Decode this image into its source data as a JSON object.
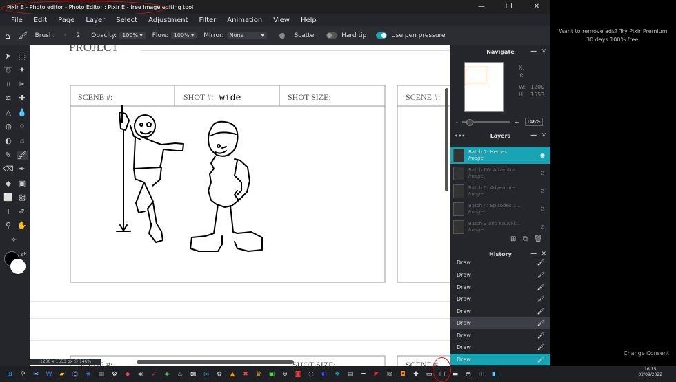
{
  "window": {
    "title": "Pixlr E - Photo editor - Photo Editor : Pixlr E - free image editing tool"
  },
  "menu": [
    "File",
    "Edit",
    "Page",
    "Layer",
    "Select",
    "Adjustment",
    "Filter",
    "Animation",
    "View",
    "Help"
  ],
  "options": {
    "brush_label": "Brush:",
    "brush_dot": "·",
    "brush_size": "2",
    "opacity_label": "Opacity:",
    "opacity_value": "100%",
    "flow_label": "Flow:",
    "flow_value": "100%",
    "mirror_label": "Mirror:",
    "mirror_value": "None",
    "scatter_label": "Scatter",
    "hardtip_label": "Hard tip",
    "penpressure_label": "Use pen pressure"
  },
  "canvas": {
    "project_label": "PROJECT",
    "scene_label": "SCENE #:",
    "shot_label": "SHOT #:",
    "shot_handwriting": "wide",
    "size_label": "SHOT SIZE:",
    "scene_label_2": "SCENE #:",
    "bottom_scene": "SCENE #:",
    "bottom_shot_size": "SHOT SIZE:",
    "bottom_scene_2": "SCENE #"
  },
  "status": {
    "dimensions": "1200 x 1553 px @ 146%"
  },
  "navigate": {
    "title": "Navigate",
    "x_label": "X:",
    "y_label": "Y:",
    "w_label": "W:",
    "w_value": "1200",
    "h_label": "H:",
    "h_value": "1553",
    "zoom_minus": "-",
    "zoom_plus": "+",
    "zoom_value": "146%"
  },
  "layers": {
    "title": "Layers",
    "items": [
      {
        "name": "Batch 7: Heroes",
        "type": "Image"
      },
      {
        "name": "Batch 06: Adventur...",
        "type": "Image"
      },
      {
        "name": "Batch 5: Adventure...",
        "type": "Image"
      },
      {
        "name": "Batch 4: Episodes 1...",
        "type": "Image"
      },
      {
        "name": "Batch 3 and Knuckl...",
        "type": "Image"
      }
    ]
  },
  "history": {
    "title": "History",
    "items": [
      "Draw",
      "Draw",
      "Draw",
      "Draw",
      "Draw",
      "Draw",
      "Draw",
      "Draw",
      "Draw"
    ]
  },
  "ad": {
    "line1": "Want to remove ads? Try Pixlr Premium",
    "line2": "30 days 100% free.",
    "consent": "Change Consent"
  },
  "clock": {
    "time": "16:15",
    "date": "02/09/2022"
  },
  "colors": {
    "accent": "#19a4b4",
    "annotation": "#e01010"
  }
}
